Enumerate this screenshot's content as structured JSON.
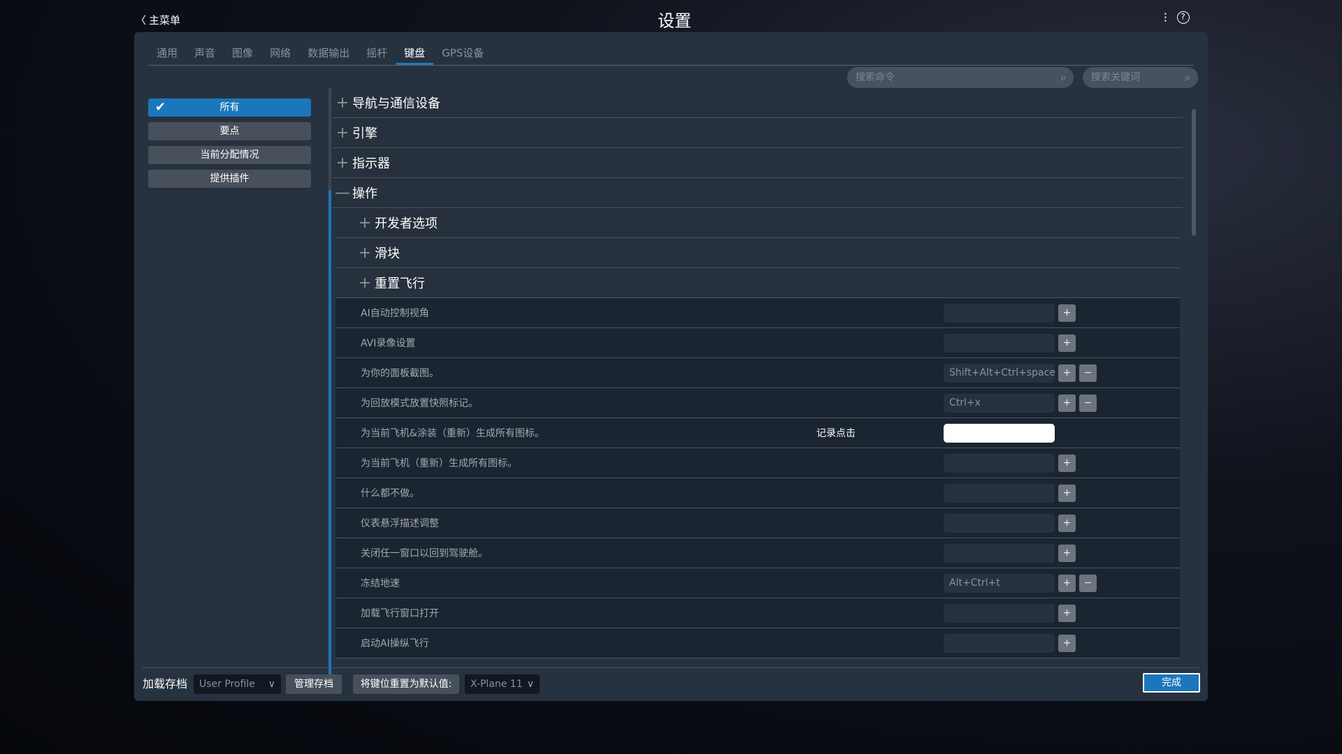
{
  "header": {
    "back_label": "主菜单",
    "title": "设置",
    "icons": [
      "sliders-icon",
      "help-icon"
    ]
  },
  "tabs": [
    {
      "label": "通用"
    },
    {
      "label": "声音"
    },
    {
      "label": "图像"
    },
    {
      "label": "网络"
    },
    {
      "label": "数据输出"
    },
    {
      "label": "摇杆"
    },
    {
      "label": "键盘",
      "active": true
    },
    {
      "label": "GPS设备"
    }
  ],
  "search": {
    "command_placeholder": "搜索命令",
    "keyword_placeholder": "搜索关键词"
  },
  "sidebar": [
    {
      "label": "所有",
      "active": true
    },
    {
      "label": "要点"
    },
    {
      "label": "当前分配情况"
    },
    {
      "label": "提供插件"
    }
  ],
  "groups": [
    {
      "label": "导航与通信设备",
      "expanded": false,
      "level": 0
    },
    {
      "label": "引擎",
      "expanded": false,
      "level": 0
    },
    {
      "label": "指示器",
      "expanded": false,
      "level": 0
    },
    {
      "label": "操作",
      "expanded": true,
      "level": 0
    },
    {
      "label": "开发者选项",
      "expanded": false,
      "level": 1
    },
    {
      "label": "滑块",
      "expanded": false,
      "level": 1
    },
    {
      "label": "重置飞行",
      "expanded": false,
      "level": 1
    }
  ],
  "commands": [
    {
      "label": "AI自动控制视角",
      "key": "",
      "remove": false
    },
    {
      "label": "AVI录像设置",
      "key": "",
      "remove": false
    },
    {
      "label": "为你的面板截图。",
      "key": "Shift+Alt+Ctrl+space",
      "remove": true
    },
    {
      "label": "为回放模式放置快照标记。",
      "key": "Ctrl+x",
      "remove": true
    },
    {
      "label": "为当前飞机&涂装（重新）生成所有图标。",
      "key": "",
      "recording": true,
      "record_label": "记录点击"
    },
    {
      "label": "为当前飞机（重新）生成所有图标。",
      "key": "",
      "remove": false
    },
    {
      "label": "什么都不做。",
      "key": "",
      "remove": false
    },
    {
      "label": "仪表悬浮描述调整",
      "key": "",
      "remove": false
    },
    {
      "label": "关闭任一窗口以回到驾驶舱。",
      "key": "",
      "remove": false
    },
    {
      "label": "冻结地速",
      "key": "Alt+Ctrl+t",
      "remove": true
    },
    {
      "label": "加载飞行窗口打开",
      "key": "",
      "remove": false
    },
    {
      "label": "启动AI操纵飞行",
      "key": "",
      "remove": false
    }
  ],
  "footer": {
    "load_label": "加载存档",
    "profile_value": "User Profile",
    "manage_label": "管理存档",
    "reset_label": "将键位重置为默认值:",
    "preset_value": "X-Plane 11",
    "done_label": "完成"
  },
  "colors": {
    "accent": "#1b77bb",
    "panel": "#273240"
  }
}
